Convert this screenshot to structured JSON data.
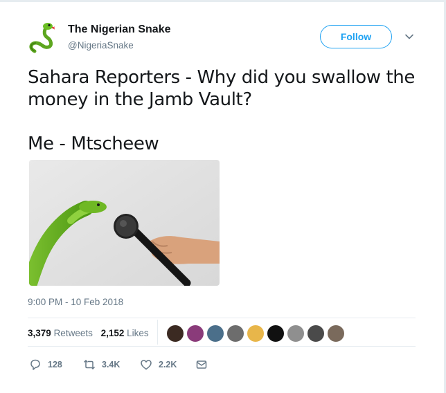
{
  "tweet": {
    "author_name": "The Nigerian Snake",
    "author_handle": "@NigeriaSnake",
    "follow_label": "Follow",
    "text_line1": "Sahara Reporters - Why did you swallow the money in the Jamb Vault?",
    "text_line2": "Me - Mtscheew",
    "timestamp": "9:00 PM - 10 Feb 2018",
    "media_icon": "snake-microphone-photo"
  },
  "stats": {
    "retweets_count": "3,379",
    "retweets_label": "Retweets",
    "likes_count": "2,152",
    "likes_label": "Likes",
    "liker_avatar_count": 9
  },
  "actions": {
    "reply_count": "128",
    "retweet_count": "3.4K",
    "like_count": "2.2K"
  },
  "colors": {
    "accent": "#1da1f2",
    "text": "#14171a",
    "secondary": "#657786",
    "border": "#e6ecf0"
  }
}
